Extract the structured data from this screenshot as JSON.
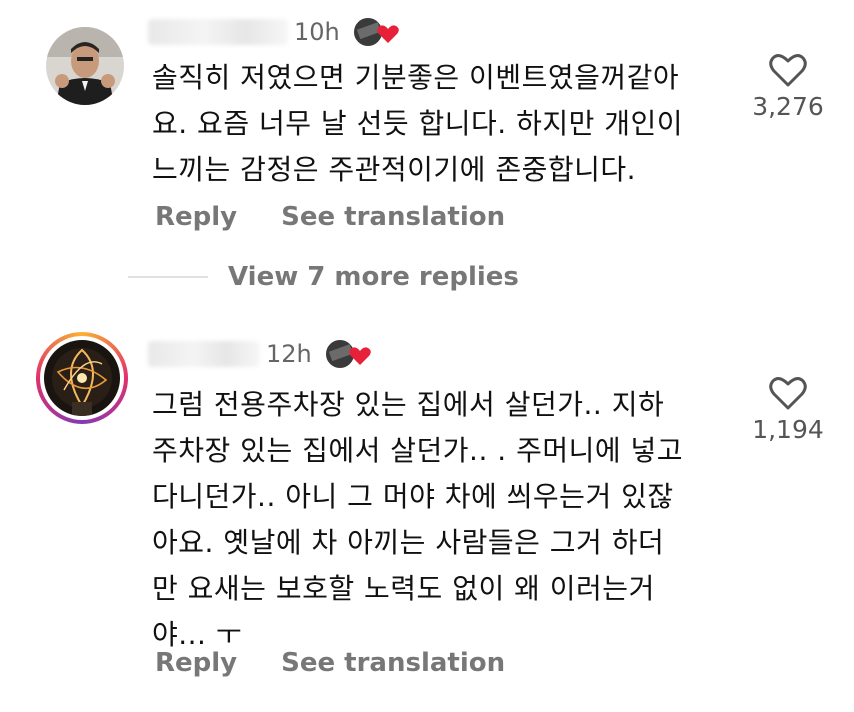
{
  "comments": [
    {
      "username": "",
      "time": "10h",
      "text": "솔직히 저였으면 기분좋은 이벤트였을꺼같아\n요. 요즘 너무 날 선듯 합니다. 하지만 개인이\n느끼는 감정은 주관적이기에 존중합니다.",
      "like_count": "3,276",
      "reply_label": "Reply",
      "translate_label": "See translation"
    },
    {
      "username": "",
      "time": "12h",
      "text": "그럼 전용주차장 있는 집에서 살던가.. 지하\n주차장 있는 집에서 살던가.. . 주머니에 넣고\n다니던가.. 아니 그 머야 차에 씌우는거 있잖\n아요. 옛날에 차 아끼는 사람들은 그거 하더\n만 요새는 보호할 노력도 없이 왜 이러는거\n야... ㅜ",
      "like_count": "1,194",
      "reply_label": "Reply",
      "translate_label": "See translation"
    }
  ],
  "view_more": "View 7 more replies",
  "colors": {
    "heart_red": "#e8213a",
    "muted": "#777777",
    "story_ring": [
      "#f9b233",
      "#e1306c",
      "#833ab4"
    ]
  },
  "icons": {
    "like": "heart-outline-icon",
    "reaction": "creator-liked-heart-icon"
  }
}
